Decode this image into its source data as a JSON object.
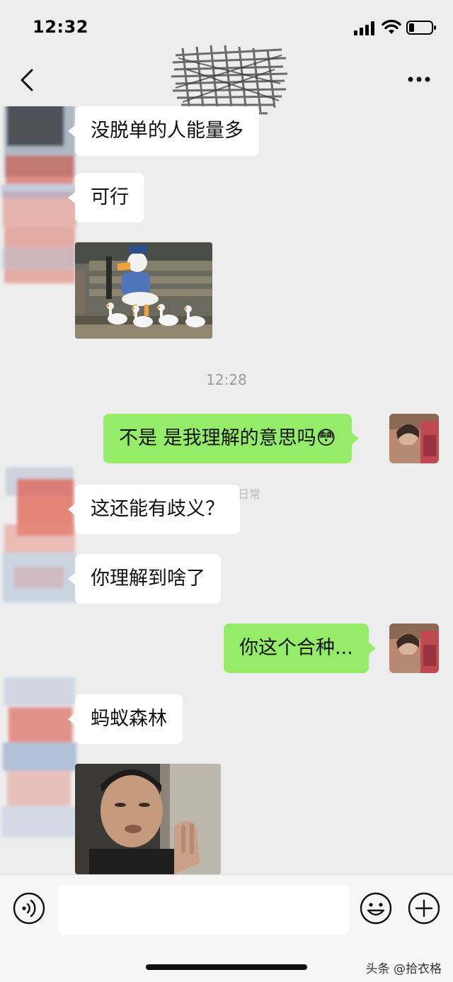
{
  "status_bar": {
    "time": "12:32"
  },
  "nav": {
    "back_icon": "chevron-left-icon",
    "more_icon": "more-dots-icon"
  },
  "messages": [
    {
      "side": "in",
      "type": "text",
      "text": "没脱单的人能量多"
    },
    {
      "side": "in",
      "type": "text",
      "text": "可行"
    },
    {
      "side": "in",
      "type": "sticker",
      "desc": "donald-duck-ducks-sticker"
    },
    {
      "type": "timestamp",
      "text": "12:28"
    },
    {
      "side": "out",
      "type": "text",
      "text": "不是 是我理解的意思吗😳"
    },
    {
      "side": "in",
      "type": "text",
      "text": "这还能有歧义？"
    },
    {
      "side": "in",
      "type": "text",
      "text": "你理解到啥了"
    },
    {
      "side": "out",
      "type": "text",
      "text": "你这个合种..."
    },
    {
      "side": "in",
      "type": "text",
      "text": "蚂蚁森林"
    },
    {
      "side": "in",
      "type": "sticker",
      "desc": "man-peeking-door-sticker"
    }
  ],
  "watermark": "@沙雕男友的日常",
  "input_bar": {
    "voice_icon": "voice-icon",
    "placeholder": "",
    "emoji_icon": "emoji-icon",
    "plus_icon": "plus-icon"
  },
  "source_mark": "头条 @拾衣格",
  "colors": {
    "background": "#ededed",
    "incoming": "#ffffff",
    "outgoing": "#95ec69"
  }
}
